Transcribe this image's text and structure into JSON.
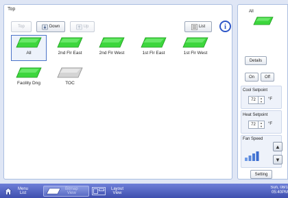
{
  "main_panel": {
    "title": "Top",
    "toolbar": {
      "top_label": "Top",
      "down_label": "Down",
      "up_label": "Up",
      "list_label": "List",
      "info_label": "i"
    },
    "tiles": [
      {
        "label": "All",
        "color": "#3dd63d",
        "selected": true
      },
      {
        "label": "2nd Flr East",
        "color": "#3dd63d"
      },
      {
        "label": "2nd Flr West",
        "color": "#3dd63d"
      },
      {
        "label": "1st Flr East",
        "color": "#3dd63d"
      },
      {
        "label": "1st Flr West",
        "color": "#3dd63d"
      },
      {
        "label": "Facility Dng",
        "color": "#3dd63d"
      },
      {
        "label": "TOC",
        "color": "#c8c8c8"
      }
    ]
  },
  "right_panel": {
    "group_name": "All",
    "details_label": "Details",
    "on_label": "On",
    "off_label": "Off",
    "cool_setpoint": {
      "label": "Cool Setpoint",
      "value": "72",
      "unit": "°F"
    },
    "heat_setpoint": {
      "label": "Heat Setpoint",
      "value": "72",
      "unit": "°F"
    },
    "fan_speed": {
      "label": "Fan Speed"
    },
    "setting_label": "Setting"
  },
  "bottom_bar": {
    "menu_label_1": "Menu",
    "menu_label_2": "List",
    "bitmap_label_1": "Bitmap",
    "bitmap_label_2": "View",
    "layout_label_1": "Layout",
    "layout_label_2": "View",
    "date": "Sun, 08/1",
    "time": "05:40PM"
  }
}
